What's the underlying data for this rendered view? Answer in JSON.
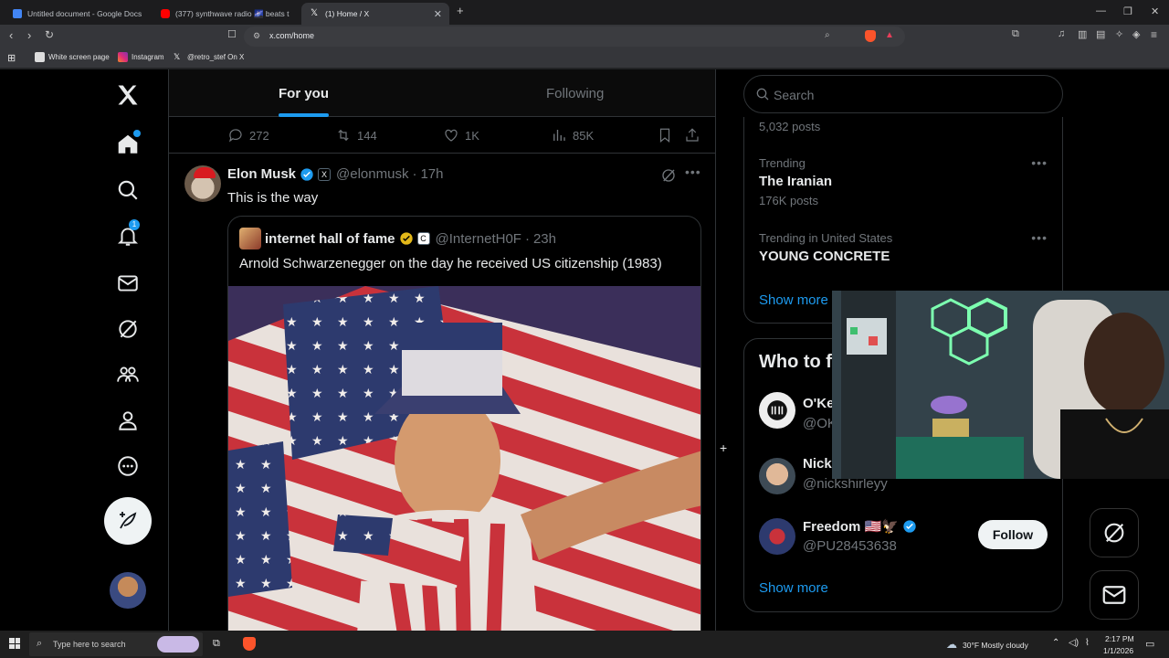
{
  "browser": {
    "tabs": [
      {
        "title": "Untitled document - Google Docs",
        "active": false
      },
      {
        "title": "(377) synthwave radio 🌌 beats t",
        "active": false
      },
      {
        "title": "(1) Home / X",
        "active": true
      }
    ],
    "url": "x.com/home",
    "bookmarks": [
      "White screen page",
      "Instagram",
      "@retro_stef On X"
    ]
  },
  "feed": {
    "tabs": [
      {
        "label": "For you",
        "selected": true
      },
      {
        "label": "Following",
        "selected": false
      }
    ],
    "prev_actions": {
      "replies": "272",
      "reposts": "144",
      "likes": "1K",
      "views": "85K"
    },
    "tweet": {
      "name": "Elon Musk",
      "affiliate": "X",
      "handle": "@elonmusk",
      "sep": "·",
      "time": "17h",
      "text": "This is the way",
      "quote": {
        "name": "internet hall of fame",
        "affiliate": "C",
        "handle": "@InternetH0F",
        "sep": "·",
        "time": "23h",
        "text": "Arnold Schwarzenegger on the day he received US citizenship (1983)"
      }
    }
  },
  "nav": {
    "notifications_badge": "1"
  },
  "sidebar": {
    "search_placeholder": "Search",
    "trends": [
      {
        "meta": "",
        "title": "",
        "posts": "5,032 posts"
      },
      {
        "meta": "Trending",
        "title": "The Iranian",
        "posts": "176K posts"
      },
      {
        "meta": "Trending in United States",
        "title": "YOUNG CONCRETE",
        "posts": ""
      }
    ],
    "trends_show_more": "Show more",
    "who_to_follow": {
      "title": "Who to f",
      "accounts": [
        {
          "name": "O'Ke",
          "handle": "@OK"
        },
        {
          "name": "Nick",
          "handle": "@nickshirleyy"
        },
        {
          "name": "Freedom 🇺🇸🦅",
          "handle": "@PU28453638",
          "follow_label": "Follow"
        }
      ],
      "show_more": "Show more"
    }
  },
  "taskbar": {
    "search_placeholder": "Type here to search",
    "weather": "30°F  Mostly cloudy",
    "time": "2:17 PM",
    "date": "1/1/2026"
  },
  "colors": {
    "accent": "#1d9bf0",
    "background": "#000000",
    "border": "#2f3336",
    "muted": "#71767b"
  }
}
